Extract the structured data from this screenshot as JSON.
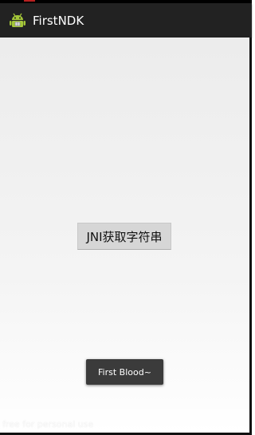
{
  "action_bar": {
    "app_icon": "android-icon",
    "title": "FirstNDK",
    "background": "#222222"
  },
  "main": {
    "button_label": "JNI获取字符串"
  },
  "toast": {
    "message": "First Blood~"
  },
  "watermark": {
    "text": "free for personal use"
  }
}
